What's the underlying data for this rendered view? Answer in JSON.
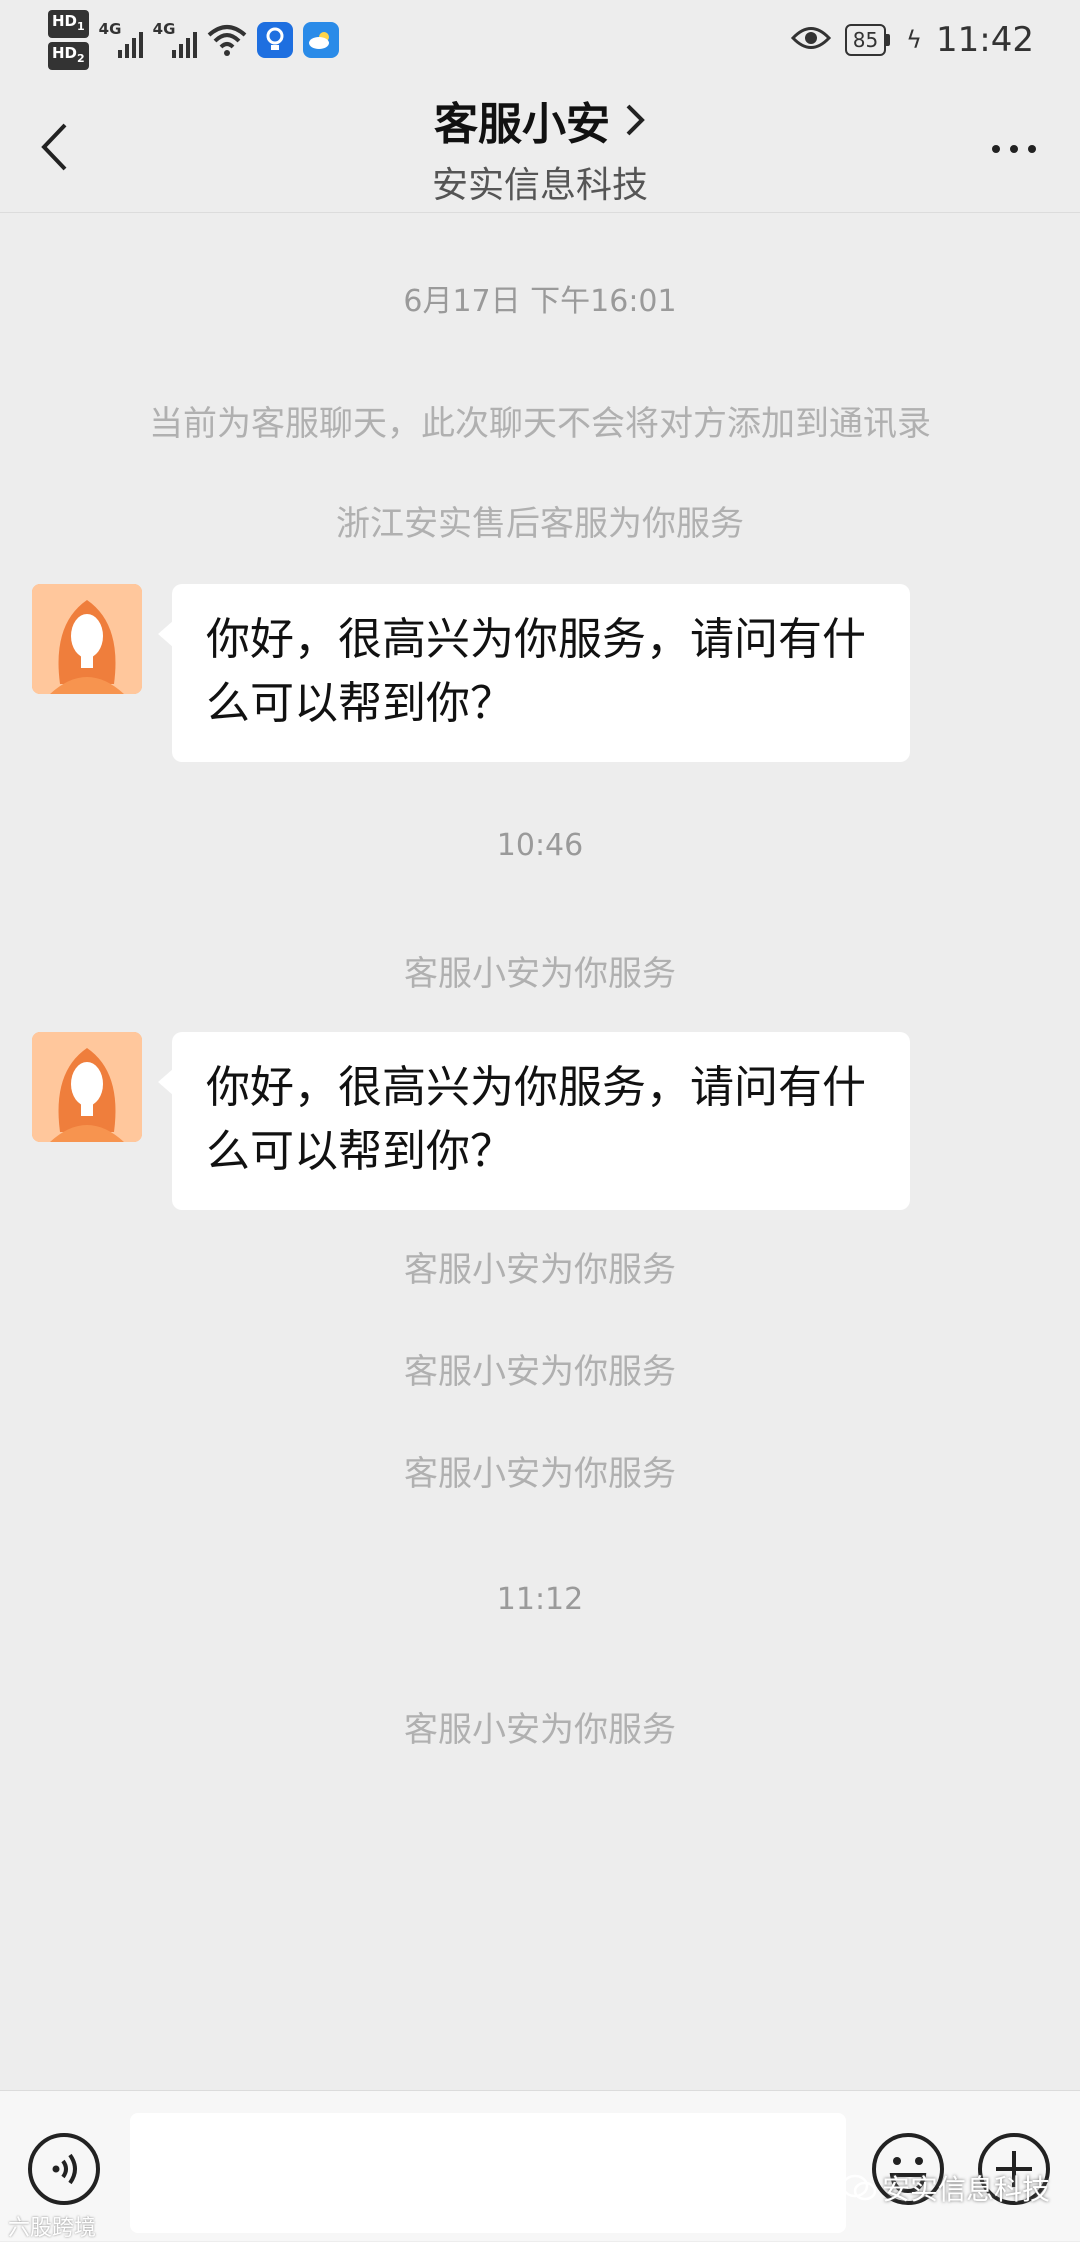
{
  "status_bar": {
    "hd1": "HD",
    "hd1_sub": "1",
    "hd2": "HD",
    "hd2_sub": "2",
    "network1": "4G",
    "network2": "4G",
    "battery": "85",
    "time": "11:42",
    "icons": [
      "wifi-icon",
      "bulb-app-icon",
      "weather-app-icon",
      "eye-icon",
      "battery-icon",
      "charging-icon"
    ]
  },
  "header": {
    "title": "客服小安",
    "subtitle": "安实信息科技",
    "icons": [
      "back-arrow-icon",
      "chevron-right-icon",
      "more-icon"
    ]
  },
  "chat": {
    "timestamp_1": "6月17日 下午16:01",
    "notice_1": "当前为客服聊天，此次聊天不会将对方添加到通讯录",
    "notice_2": "浙江安实售后客服为你服务",
    "message_1": "你好，很高兴为你服务，请问有什么可以帮到你？",
    "timestamp_2": "10:46",
    "notice_3": "客服小安为你服务",
    "message_2": "你好，很高兴为你服务，请问有什么可以帮到你？",
    "notice_4": "客服小安为你服务",
    "notice_5": "客服小安为你服务",
    "notice_6": "客服小安为你服务",
    "timestamp_3": "11:12",
    "notice_7": "客服小安为你服务"
  },
  "input_bar": {
    "input_value": "",
    "icons": [
      "voice-icon",
      "emoji-icon",
      "plus-icon"
    ]
  },
  "watermarks": {
    "left": "六股跨境",
    "right": "安实信息科技"
  },
  "colors": {
    "background": "#ededed",
    "bubble": "#ffffff",
    "avatar": "#ffb27a",
    "system_text": "#b0b0b0"
  }
}
